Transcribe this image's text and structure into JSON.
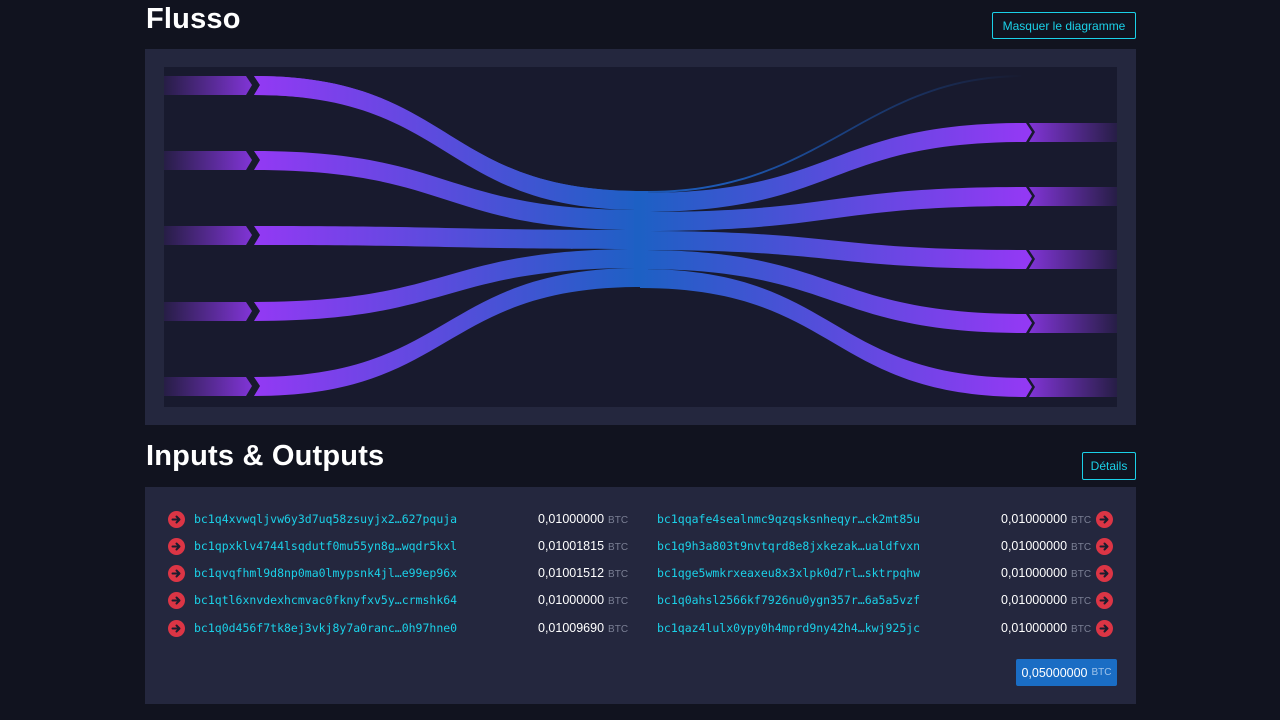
{
  "flow": {
    "title": "Flusso",
    "hide_button": "Masquer le diagramme"
  },
  "io": {
    "title": "Inputs & Outputs",
    "details_button": "Détails",
    "unit": "BTC",
    "inputs": [
      {
        "address": "bc1q4xvwqljvw6y3d7uq58zsuyjx2…627pquja",
        "amount": "0,01000000"
      },
      {
        "address": "bc1qpxklv4744lsqdutf0mu55yn8g…wqdr5kxl",
        "amount": "0,01001815"
      },
      {
        "address": "bc1qvqfhml9d8np0ma0lmypsnk4jl…e99ep96x",
        "amount": "0,01001512"
      },
      {
        "address": "bc1qtl6xnvdexhcmvac0fknyfxv5y…crmshk64",
        "amount": "0,01000000"
      },
      {
        "address": "bc1q0d456f7tk8ej3vkj8y7a0ranc…0h97hne0",
        "amount": "0,01009690"
      }
    ],
    "outputs": [
      {
        "address": "bc1qqafe4sealnmc9qzqsksnheqyr…ck2mt85u",
        "amount": "0,01000000"
      },
      {
        "address": "bc1q9h3a803t9nvtqrd8e8jxkezak…ualdfvxn",
        "amount": "0,01000000"
      },
      {
        "address": "bc1qge5wmkrxeaxeu8x3xlpk0d7rl…sktrpqhw",
        "amount": "0,01000000"
      },
      {
        "address": "bc1q0ahsl2566kf7926nu0ygn357r…6a5a5vzf",
        "amount": "0,01000000"
      },
      {
        "address": "bc1qaz4lulx0ypy0h4mprd9ny42h4…kwj925jc",
        "amount": "0,01000000"
      }
    ],
    "total": "0,05000000"
  },
  "colors": {
    "background": "#11131f",
    "panel": "#24273e",
    "accent_cyan": "#1bd1e8",
    "flow_purple": "#9339f4",
    "flow_blue": "#1a6dc4",
    "input_arrow_red": "#dc3545"
  },
  "icons": {
    "input": "arrow-right-circle-icon",
    "output": "arrow-right-circle-icon"
  }
}
